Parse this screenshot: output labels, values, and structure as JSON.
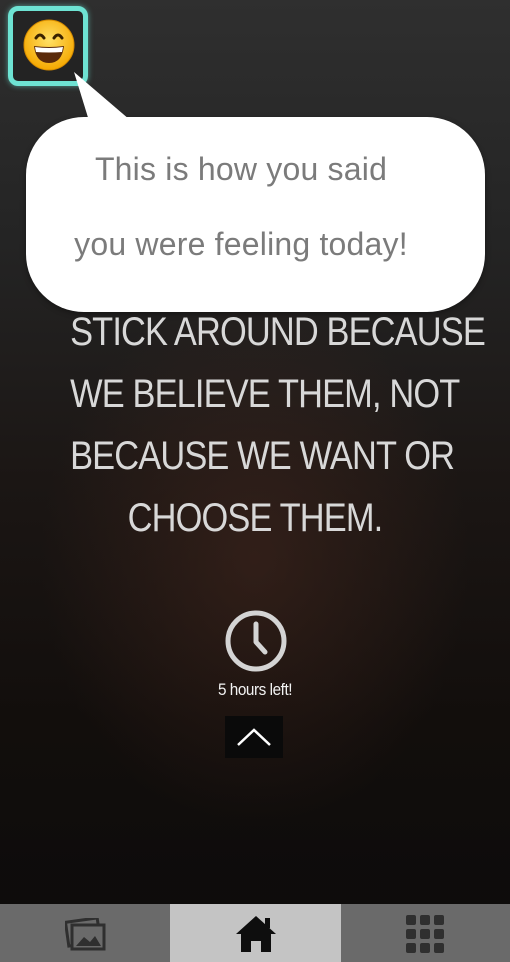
{
  "mood": {
    "emoji": "grinning-face",
    "frame_color": "#6ee3d3"
  },
  "bubble": {
    "line1": "This is how you said",
    "line2": "you were feeling today!"
  },
  "quote": {
    "lines": [
      "STICK AROUND BECAUSE",
      "WE BELIEVE THEM, NOT",
      "BECAUSE WE WANT OR",
      "CHOOSE THEM."
    ]
  },
  "timer": {
    "icon": "clock-icon",
    "label": "5 hours left!"
  },
  "expand": {
    "icon": "chevron-up-icon"
  },
  "tabbar": {
    "items": [
      {
        "name": "gallery",
        "icon": "photos-icon",
        "active": false
      },
      {
        "name": "home",
        "icon": "home-icon",
        "active": true
      },
      {
        "name": "menu",
        "icon": "grid-icon",
        "active": false
      }
    ]
  }
}
